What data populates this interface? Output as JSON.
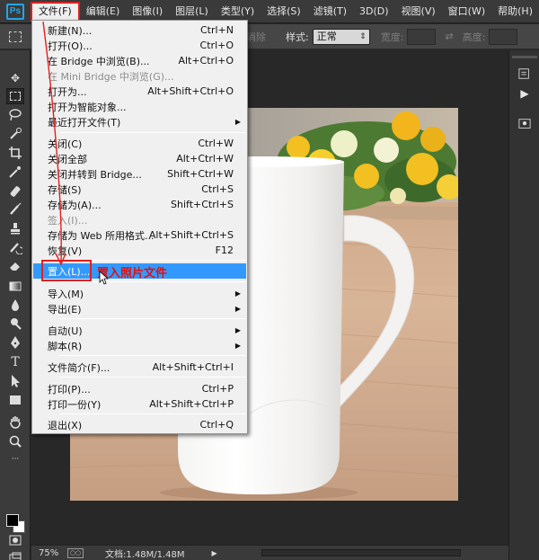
{
  "menubar": {
    "logo": "Ps",
    "items": [
      "文件(F)",
      "编辑(E)",
      "图像(I)",
      "图层(L)",
      "类型(Y)",
      "选择(S)",
      "滤镜(T)",
      "3D(D)",
      "视图(V)",
      "窗口(W)",
      "帮助(H)"
    ]
  },
  "options": {
    "hidden_fragment": "消除",
    "style_label": "样式:",
    "style_value": "正常",
    "width_label": "宽度:",
    "height_label": "高度:"
  },
  "file_menu": {
    "items": [
      {
        "label": "新建(N)...",
        "shortcut": "Ctrl+N"
      },
      {
        "label": "打开(O)...",
        "shortcut": "Ctrl+O"
      },
      {
        "label": "在 Bridge 中浏览(B)...",
        "shortcut": "Alt+Ctrl+O"
      },
      {
        "label": "在 Mini Bridge 中浏览(G)...",
        "shortcut": ""
      },
      {
        "label": "打开为...",
        "shortcut": "Alt+Shift+Ctrl+O"
      },
      {
        "label": "打开为智能对象...",
        "shortcut": ""
      },
      {
        "label": "最近打开文件(T)",
        "shortcut": ""
      },
      {
        "label": "关闭(C)",
        "shortcut": "Ctrl+W"
      },
      {
        "label": "关闭全部",
        "shortcut": "Alt+Ctrl+W"
      },
      {
        "label": "关闭并转到 Bridge...",
        "shortcut": "Shift+Ctrl+W"
      },
      {
        "label": "存储(S)",
        "shortcut": "Ctrl+S"
      },
      {
        "label": "存储为(A)...",
        "shortcut": "Shift+Ctrl+S"
      },
      {
        "label": "签入(I)...",
        "shortcut": ""
      },
      {
        "label": "存储为 Web 所用格式...",
        "shortcut": "Alt+Shift+Ctrl+S"
      },
      {
        "label": "恢复(V)",
        "shortcut": "F12"
      },
      {
        "label": "置入(L)...",
        "shortcut": ""
      },
      {
        "label": "导入(M)",
        "shortcut": ""
      },
      {
        "label": "导出(E)",
        "shortcut": ""
      },
      {
        "label": "自动(U)",
        "shortcut": ""
      },
      {
        "label": "脚本(R)",
        "shortcut": ""
      },
      {
        "label": "文件简介(F)...",
        "shortcut": "Alt+Shift+Ctrl+I"
      },
      {
        "label": "打印(P)...",
        "shortcut": "Ctrl+P"
      },
      {
        "label": "打印一份(Y)",
        "shortcut": "Alt+Shift+Ctrl+P"
      },
      {
        "label": "退出(X)",
        "shortcut": "Ctrl+Q"
      }
    ]
  },
  "annotation": "置入照片文件",
  "status": {
    "zoom": "75%",
    "doc_info": "文档:1.48M/1.48M"
  },
  "colors": {
    "highlight": "#3399ff",
    "annotation_red": "#e02020"
  }
}
